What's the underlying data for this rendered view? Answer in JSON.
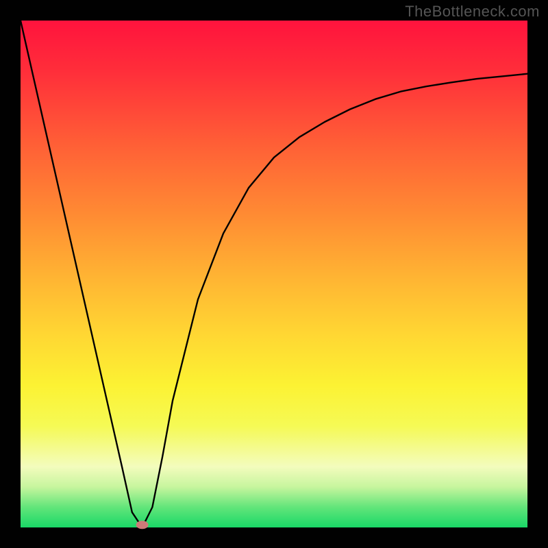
{
  "watermark_text": "TheBottleneck.com",
  "chart_data": {
    "type": "line",
    "title": "",
    "xlabel": "",
    "ylabel": "",
    "xlim": [
      0,
      100
    ],
    "ylim": [
      0,
      100
    ],
    "grid": false,
    "legend": false,
    "series": [
      {
        "name": "bottleneck-curve",
        "x": [
          0,
          5,
          10,
          15,
          20,
          22,
          24,
          26,
          28,
          30,
          35,
          40,
          45,
          50,
          55,
          60,
          65,
          70,
          75,
          80,
          85,
          90,
          95,
          100
        ],
        "values": [
          100,
          78,
          56,
          34,
          12,
          3,
          0,
          4,
          14,
          25,
          45,
          58,
          67,
          73,
          77,
          80,
          82.5,
          84.5,
          86,
          87,
          87.8,
          88.5,
          89,
          89.5
        ]
      }
    ],
    "marker": {
      "x": 24,
      "y": 0.5,
      "color": "#cd7a78"
    },
    "background_gradient": {
      "direction": "vertical",
      "stops": [
        {
          "pos": 0,
          "color": "#ff133d"
        },
        {
          "pos": 50,
          "color": "#ffb233"
        },
        {
          "pos": 80,
          "color": "#f5fa55"
        },
        {
          "pos": 100,
          "color": "#19d867"
        }
      ]
    }
  }
}
